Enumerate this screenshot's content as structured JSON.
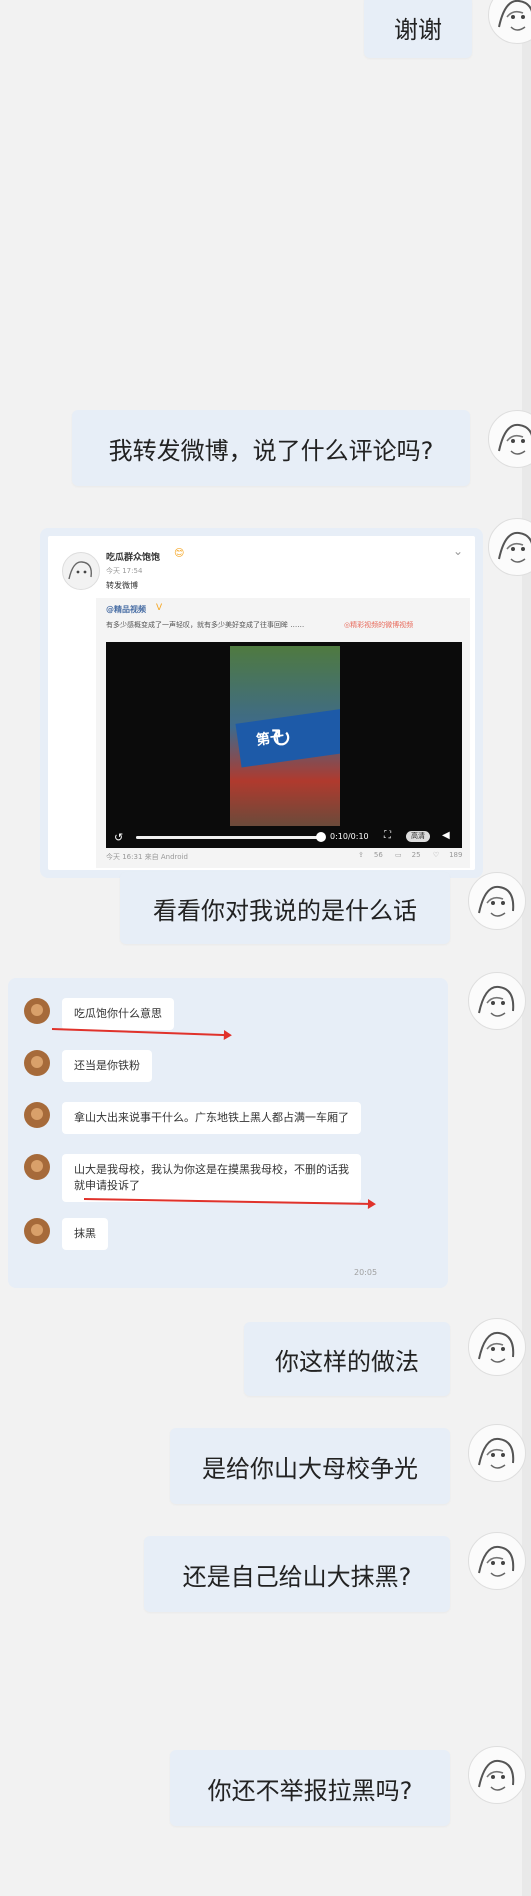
{
  "messages": {
    "m1": "谢谢",
    "m2": "我转发微博，说了什么评论吗?",
    "m3": "看看你对我说的是什么话",
    "m4": "你这样的做法",
    "m5": "是给你山大母校争光",
    "m6": "还是自己给山大抹黑?",
    "m7": "你还不举报拉黑吗?"
  },
  "weibo": {
    "name": "吃瓜群众饱饱",
    "emoji": "😊",
    "time": "今天 17:54",
    "repost_text": "转发微博",
    "orig_author": "@精品视频",
    "orig_badge": "V",
    "orig_text": "有多少感概变成了一声轻叹，就有多少美好变成了往事回眸 ……",
    "orig_link": "◎精彩视频的微博视频",
    "video_sign": "第十",
    "video_time": "0:10/0:10",
    "video_quality": "高清",
    "footer_time": "今天 16:31 来自 Android",
    "reposts": "56",
    "comments": "25",
    "likes": "189",
    "video_progress": 1.0
  },
  "quoted": {
    "q1": "吃瓜饱你什么意思",
    "q2": "还当是你铁粉",
    "q3": "拿山大出来说事干什么。广东地铁上黑人都占满一车厢了",
    "q4a": "山大是我母校，我认为你这是在摸黑我母校，不删的话我",
    "q4b": "就申请投诉了",
    "q5": "抹黑",
    "time": "20:05"
  }
}
